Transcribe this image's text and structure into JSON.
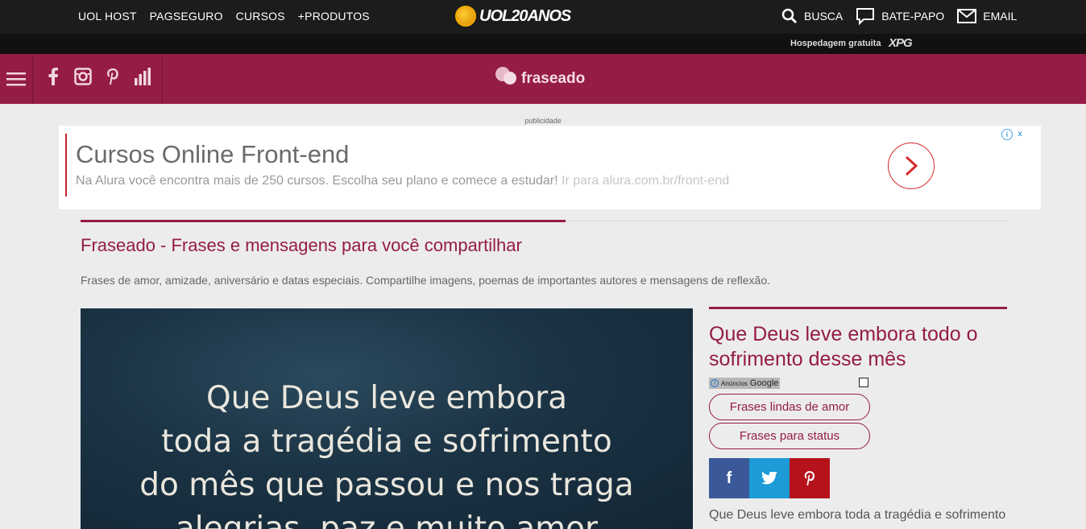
{
  "uol": {
    "links": [
      "UOL HOST",
      "PAGSEGURO",
      "CURSOS",
      "+PRODUTOS"
    ],
    "logo_text": "UOL20ANOS",
    "search_label": "BUSCA",
    "chat_label": "BATE-PAPO",
    "email_label": "EMAIL",
    "hosting_text": "Hospedagem gratuita",
    "xpg": "XPG"
  },
  "header": {
    "brand": "fraseado",
    "social_icons": [
      "menu-icon",
      "facebook-icon",
      "instagram-icon",
      "pinterest-icon",
      "stats-icon"
    ]
  },
  "ad": {
    "label": "publicidade",
    "title": "Cursos Online Front-end",
    "description": "Na Alura você encontra mais de 250 cursos. Escolha seu plano e comece a estudar!",
    "url_text": "Ir para alura.com.br/front-end",
    "choices": [
      "i",
      "x"
    ]
  },
  "main": {
    "title": "Fraseado - Frases e mensagens para você compartilhar",
    "subtitle": "Frases de amor, amizade, aniversário e datas especiais. Compartilhe imagens, poemas de importantes autores e mensagens de reflexão.",
    "image_quote": [
      "Que Deus leve embora",
      "toda a tragédia e sofrimento",
      "do mês que passou e nos traga",
      "alegrias, paz e muito amor"
    ]
  },
  "side": {
    "title": "Que Deus leve embora todo o sofrimento desse mês",
    "ads_small": "Anúncios",
    "ads_google": "Google",
    "pills": [
      "Frases lindas de amor",
      "Frases para status"
    ],
    "share": [
      "f",
      "t",
      "p"
    ],
    "text": "Que Deus leve embora toda a tragédia e sofrimento do mês que passou e nos traga"
  },
  "colors": {
    "brand": "#941c46",
    "facebook": "#3b5998",
    "twitter": "#1c9bd6",
    "pinterest": "#b5121b"
  }
}
